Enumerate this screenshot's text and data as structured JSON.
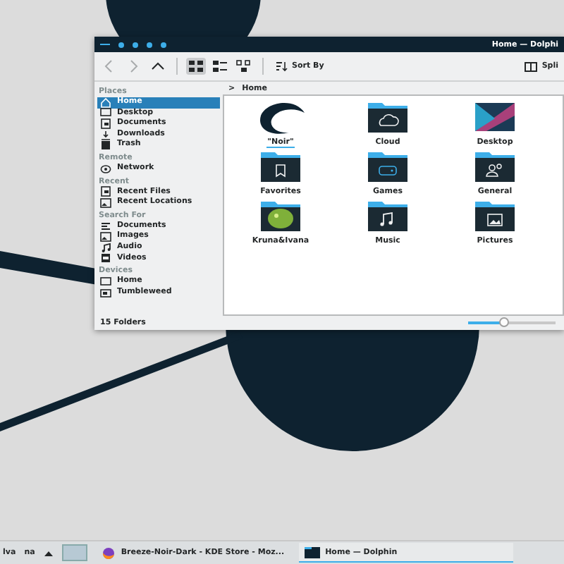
{
  "window": {
    "title": "Home — Dolphi"
  },
  "toolbar": {
    "buttons": [
      {
        "kind": "back",
        "disabled": true
      },
      {
        "kind": "forward",
        "disabled": true
      },
      {
        "kind": "up",
        "disabled": false
      }
    ],
    "views": [
      {
        "kind": "icons",
        "selected": true
      },
      {
        "kind": "compact",
        "selected": false
      },
      {
        "kind": "details",
        "selected": false
      }
    ],
    "sort_label": "Sort By",
    "split_label": "Spli"
  },
  "sidebar": {
    "sections": [
      {
        "heading": "Places",
        "items": [
          {
            "label": "Home",
            "kind": "home",
            "selected": true
          },
          {
            "label": "Desktop",
            "kind": "monitor",
            "selected": false
          },
          {
            "label": "Documents",
            "kind": "doc",
            "selected": false
          },
          {
            "label": "Downloads",
            "kind": "download",
            "selected": false
          },
          {
            "label": "Trash",
            "kind": "trash",
            "selected": false
          }
        ]
      },
      {
        "heading": "Remote",
        "items": [
          {
            "label": "Network",
            "kind": "network",
            "selected": false
          }
        ]
      },
      {
        "heading": "Recent",
        "items": [
          {
            "label": "Recent Files",
            "kind": "doc",
            "selected": false
          },
          {
            "label": "Recent Locations",
            "kind": "image",
            "selected": false
          }
        ]
      },
      {
        "heading": "Search For",
        "items": [
          {
            "label": "Documents",
            "kind": "lines",
            "selected": false
          },
          {
            "label": "Images",
            "kind": "image",
            "selected": false
          },
          {
            "label": "Audio",
            "kind": "music",
            "selected": false
          },
          {
            "label": "Videos",
            "kind": "film",
            "selected": false
          }
        ]
      },
      {
        "heading": "Devices",
        "items": [
          {
            "label": "Home",
            "kind": "monitor",
            "selected": false
          },
          {
            "label": "Tumbleweed",
            "kind": "drive",
            "selected": false
          }
        ]
      }
    ]
  },
  "breadcrumb": {
    "separator": ">",
    "current": "Home"
  },
  "files": [
    {
      "name": "\"Noir\"",
      "kind": "logo",
      "selected": true
    },
    {
      "name": "Cloud",
      "kind": "cloud",
      "selected": false
    },
    {
      "name": "Desktop",
      "kind": "wallpaper",
      "selected": false
    },
    {
      "name": "Favorites",
      "kind": "bookmark",
      "selected": false
    },
    {
      "name": "Games",
      "kind": "gamepad",
      "selected": false
    },
    {
      "name": "General",
      "kind": "users",
      "selected": false
    },
    {
      "name": "Kruna&Ivana",
      "kind": "photo",
      "selected": false
    },
    {
      "name": "Music",
      "kind": "music",
      "selected": false
    },
    {
      "name": "Pictures",
      "kind": "picture",
      "selected": false
    }
  ],
  "status_bar": {
    "text": "15 Folders",
    "zoom": {
      "level": 0.4
    }
  },
  "taskbar": {
    "tray_texts": [
      "lva",
      "na"
    ],
    "tasks": [
      {
        "label": "Breeze-Noir-Dark - KDE Store - Moz...",
        "kind": "browser",
        "selected": false
      },
      {
        "label": "Home — Dolphin",
        "kind": "folder",
        "selected": true
      }
    ]
  }
}
